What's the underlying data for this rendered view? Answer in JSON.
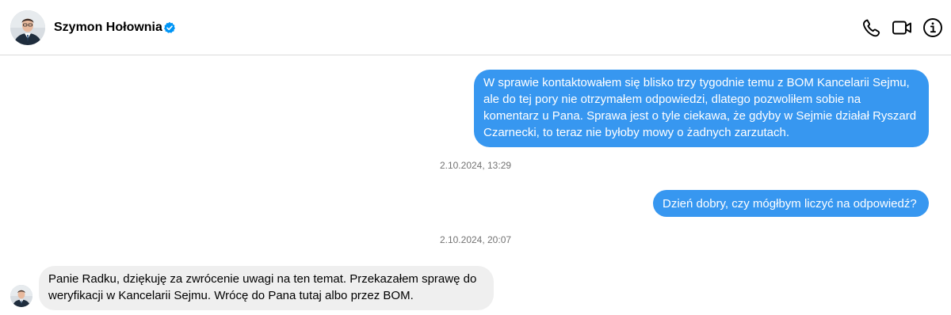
{
  "contact": {
    "name": "Szymon Hołownia",
    "verified": true,
    "avatar_icon": "person-avatar"
  },
  "header_actions": [
    {
      "icon": "phone-icon",
      "label": "Audio call"
    },
    {
      "icon": "video-camera-icon",
      "label": "Video call"
    },
    {
      "icon": "info-icon",
      "label": "Conversation information"
    }
  ],
  "colors": {
    "outgoing_bubble": "#3797f0",
    "incoming_bubble": "#efefef",
    "verified_badge": "#0095f6",
    "timestamp": "#737373"
  },
  "messages": [
    {
      "direction": "outgoing",
      "text": "W sprawie kontaktowałem się blisko trzy tygodnie temu z BOM Kancelarii Sejmu,\nale do tej pory nie otrzymałem odpowiedzi, dlatego pozwoliłem sobie na\nkomentarz u Pana. Sprawa jest o tyle ciekawa, że gdyby w Sejmie działał Ryszard\nCzarnecki, to teraz nie byłoby mowy o żadnych zarzutach."
    },
    {
      "direction": "timestamp",
      "text": "2.10.2024, 13:29"
    },
    {
      "direction": "outgoing",
      "text": "Dzień dobry, czy mógłbym liczyć na odpowiedź?"
    },
    {
      "direction": "timestamp",
      "text": "2.10.2024, 20:07"
    },
    {
      "direction": "incoming",
      "text": "Panie Radku, dziękuję za zwrócenie uwagi na ten temat. Przekazałem sprawę do\nweryfikacji w Kancelarii Sejmu. Wrócę do Pana tutaj albo przez BOM."
    }
  ]
}
